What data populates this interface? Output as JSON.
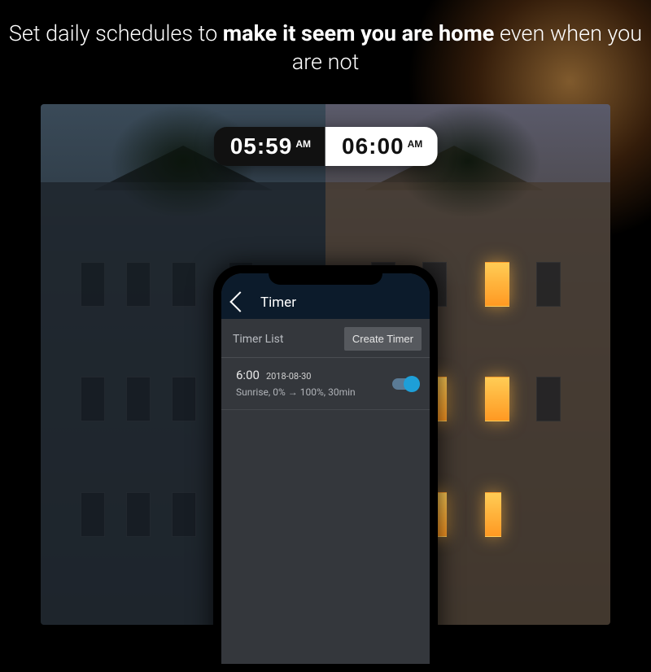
{
  "headline": {
    "part1": "Set daily schedules to ",
    "bold": "make it seem you are home",
    "part2": " even when you are not"
  },
  "time_compare": {
    "left_time": "05:59",
    "left_period": "AM",
    "right_time": "06:00",
    "right_period": "AM"
  },
  "app": {
    "title": "Timer",
    "list_label": "Timer List",
    "create_button": "Create Timer",
    "timers": [
      {
        "time": "6:00",
        "date": "2018-08-30",
        "detail": "Sunrise, 0% → 100%, 30min",
        "enabled": true
      }
    ]
  }
}
